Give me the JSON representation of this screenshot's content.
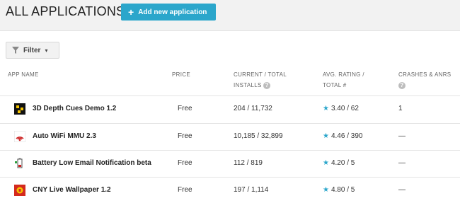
{
  "header": {
    "title": "ALL APPLICATIONS",
    "add_button": "Add new application",
    "add_icon": "plus-icon"
  },
  "filter": {
    "label": "Filter",
    "icon": "funnel-icon",
    "caret": "▾"
  },
  "columns": {
    "app_name": "APP NAME",
    "price": "PRICE",
    "installs_1": "CURRENT / TOTAL",
    "installs_2": "INSTALLS",
    "rating_1": "AVG. RATING /",
    "rating_2": "TOTAL #",
    "crashes": "CRASHES & ANRS",
    "help": "?"
  },
  "rows": [
    {
      "name": "3D Depth Cues Demo 1.2",
      "price": "Free",
      "installs": "204  /  11,732",
      "rating": "3.40  /  62",
      "crashes": "1",
      "icon": "depth-cues-app-icon"
    },
    {
      "name": "Auto WiFi MMU 2.3",
      "price": "Free",
      "installs": "10,185  /  32,899",
      "rating": "4.46  /  390",
      "crashes": "—",
      "icon": "wifi-app-icon"
    },
    {
      "name": "Battery Low Email Notification beta",
      "price": "Free",
      "installs": "112  /  819",
      "rating": "4.20  /  5",
      "crashes": "—",
      "icon": "battery-app-icon"
    },
    {
      "name": "CNY Live Wallpaper 1.2",
      "price": "Free",
      "installs": "197  /  1,114",
      "rating": "4.80  /  5",
      "crashes": "—",
      "icon": "wallpaper-app-icon"
    }
  ],
  "colors": {
    "accent": "#2ba6cb",
    "header_bg": "#f2f2f2"
  }
}
